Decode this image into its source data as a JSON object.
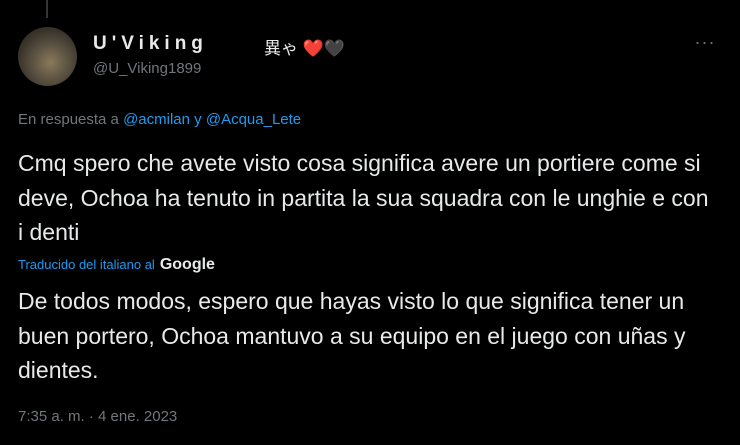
{
  "author": {
    "display_name": "U'Viking",
    "name_emoji": "異ゃ ❤️🖤",
    "handle": "@U_Viking1899"
  },
  "more_label": "···",
  "reply_context": {
    "prefix": "En respuesta a ",
    "mention_1": "@acmilan",
    "joiner": " y ",
    "mention_2": "@Acqua_Lete"
  },
  "tweet": {
    "text": "Cmq spero che avete visto cosa significa avere un portiere come si deve, Ochoa ha tenuto in partita la sua squadra con le unghie e con i denti",
    "translation_label": "Traducido del italiano al",
    "translation_provider": "Google",
    "translated_text": "De todos modos, espero que hayas visto lo que significa tener un buen portero, Ochoa mantuvo a su equipo en el juego con uñas y dientes.",
    "timestamp": "7:35 a. m. · 4 ene. 2023"
  },
  "colors": {
    "background": "#000000",
    "text": "#e7e9ea",
    "secondary": "#71767b",
    "accent": "#1d9bf0"
  }
}
